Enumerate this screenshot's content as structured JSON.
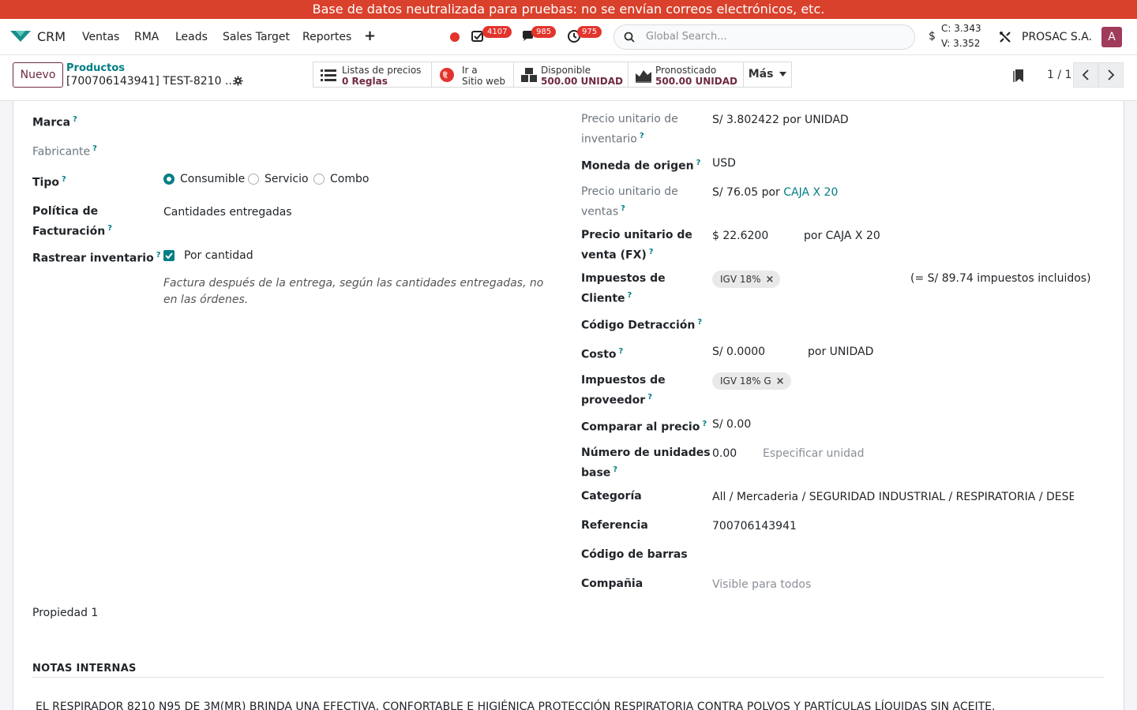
{
  "banner": "Base de datos neutralizada para pruebas: no se envían correos electrónicos, etc.",
  "navbar": {
    "app": "CRM",
    "menu": [
      "Ventas",
      "RMA",
      "Leads",
      "Sales Target",
      "Reportes"
    ],
    "plus": "+",
    "activities_count": "4107",
    "messages_count": "985",
    "timer_count": "975",
    "search_placeholder": "Global Search...",
    "currency_sign": "$",
    "rate_buy": "C: 3.343",
    "rate_sell": "V: 3.352",
    "company": "PROSAC S.A.",
    "avatar_letter": "A"
  },
  "control": {
    "new_label": "Nuevo",
    "breadcrumb": "Productos",
    "record_title": "[700706143941] TEST-8210 ...",
    "smart_buttons": [
      {
        "top": "Listas de precios",
        "bottom": "0  Reglas"
      },
      {
        "top": "Ir a",
        "bottom": "Sitio web"
      },
      {
        "top": "Disponible",
        "bottom": "500.00 UNIDAD"
      },
      {
        "top": "Pronosticado",
        "bottom": "500.00 UNIDAD"
      }
    ],
    "more_label": "Más",
    "pager": "1 / 1"
  },
  "left": {
    "marca": "Marca",
    "fabricante": "Fabricante",
    "tipo": "Tipo",
    "tipo_options": [
      "Consumible",
      "Servicio",
      "Combo"
    ],
    "politica_line1": "Política de",
    "politica_line2": "Facturación",
    "politica_value": "Cantidades entregadas",
    "rastrear": "Rastrear inventario",
    "rastrear_value": "Por cantidad",
    "note": "Factura después de la entrega, según las cantidades entregadas, no en las órdenes.",
    "propiedad": "Propiedad 1"
  },
  "right": {
    "precio_inv_line1": "Precio unitario de",
    "precio_inv_line2": "inventario",
    "precio_inv_value": "S/ 3.802422 por UNIDAD",
    "moneda": "Moneda de origen",
    "moneda_value": "USD",
    "precio_ventas_line1": "Precio unitario de",
    "precio_ventas_line2": "ventas",
    "precio_ventas_value": "S/ 76.05 por ",
    "precio_ventas_unit": "CAJA X 20",
    "precio_fx_line1": "Precio unitario de",
    "precio_fx_line2": "venta (FX)",
    "precio_fx_value": "$ 22.6200",
    "precio_fx_unit": "por CAJA X 20",
    "imp_cliente_line1": "Impuestos de",
    "imp_cliente_line2": "Cliente",
    "imp_cliente_tag": "IGV 18%",
    "imp_cliente_total": "(= S/ 89.74 impuestos incluidos)",
    "detraccion": "Código Detracción",
    "costo": "Costo",
    "costo_value": "S/ 0.0000",
    "costo_unit": "por UNIDAD",
    "imp_prov_line1": "Impuestos de",
    "imp_prov_line2": "proveedor",
    "imp_prov_tag": "IGV 18% G",
    "comparar": "Comparar al precio",
    "comparar_value": "S/ 0.00",
    "unidades_line1": "Número de unidades",
    "unidades_line2": "base",
    "unidades_value": "0.00",
    "unidades_placeholder": "Especificar unidad",
    "categoria": "Categoría",
    "categoria_value": "All / Mercaderia / SEGURIDAD INDUSTRIAL / RESPIRATORIA / DESECHA",
    "referencia": "Referencia",
    "referencia_value": "700706143941",
    "barras": "Código de barras",
    "compania": "Compañia",
    "compania_value": "Visible para todos"
  },
  "notes": {
    "title": "NOTAS INTERNAS",
    "text": "EL RESPIRADOR 8210 N95 DE 3M(MR) BRINDA UNA EFECTIVA, CONFORTABLE E HIGIÉNICA PROTECCIÓN RESPIRATORIA CONTRA POLVOS Y PARTÍCULAS LÍQUIDAS SIN ACEITE."
  },
  "colors": {
    "accent": "#017e84",
    "brand": "#6f2a43",
    "banner": "#d9412c",
    "badge": "#e2342d"
  },
  "icons": [
    "odoo-logo-icon",
    "record-dot-icon",
    "activity-check-icon",
    "chat-icon",
    "timer-icon",
    "search-icon",
    "tools-icon",
    "gear-icon",
    "list-icon",
    "globe-icon",
    "boxes-icon",
    "area-chart-icon",
    "caret-down-icon",
    "bookmark-icon",
    "chevron-left-icon",
    "chevron-right-icon",
    "checkmark-icon",
    "close-x-icon"
  ]
}
